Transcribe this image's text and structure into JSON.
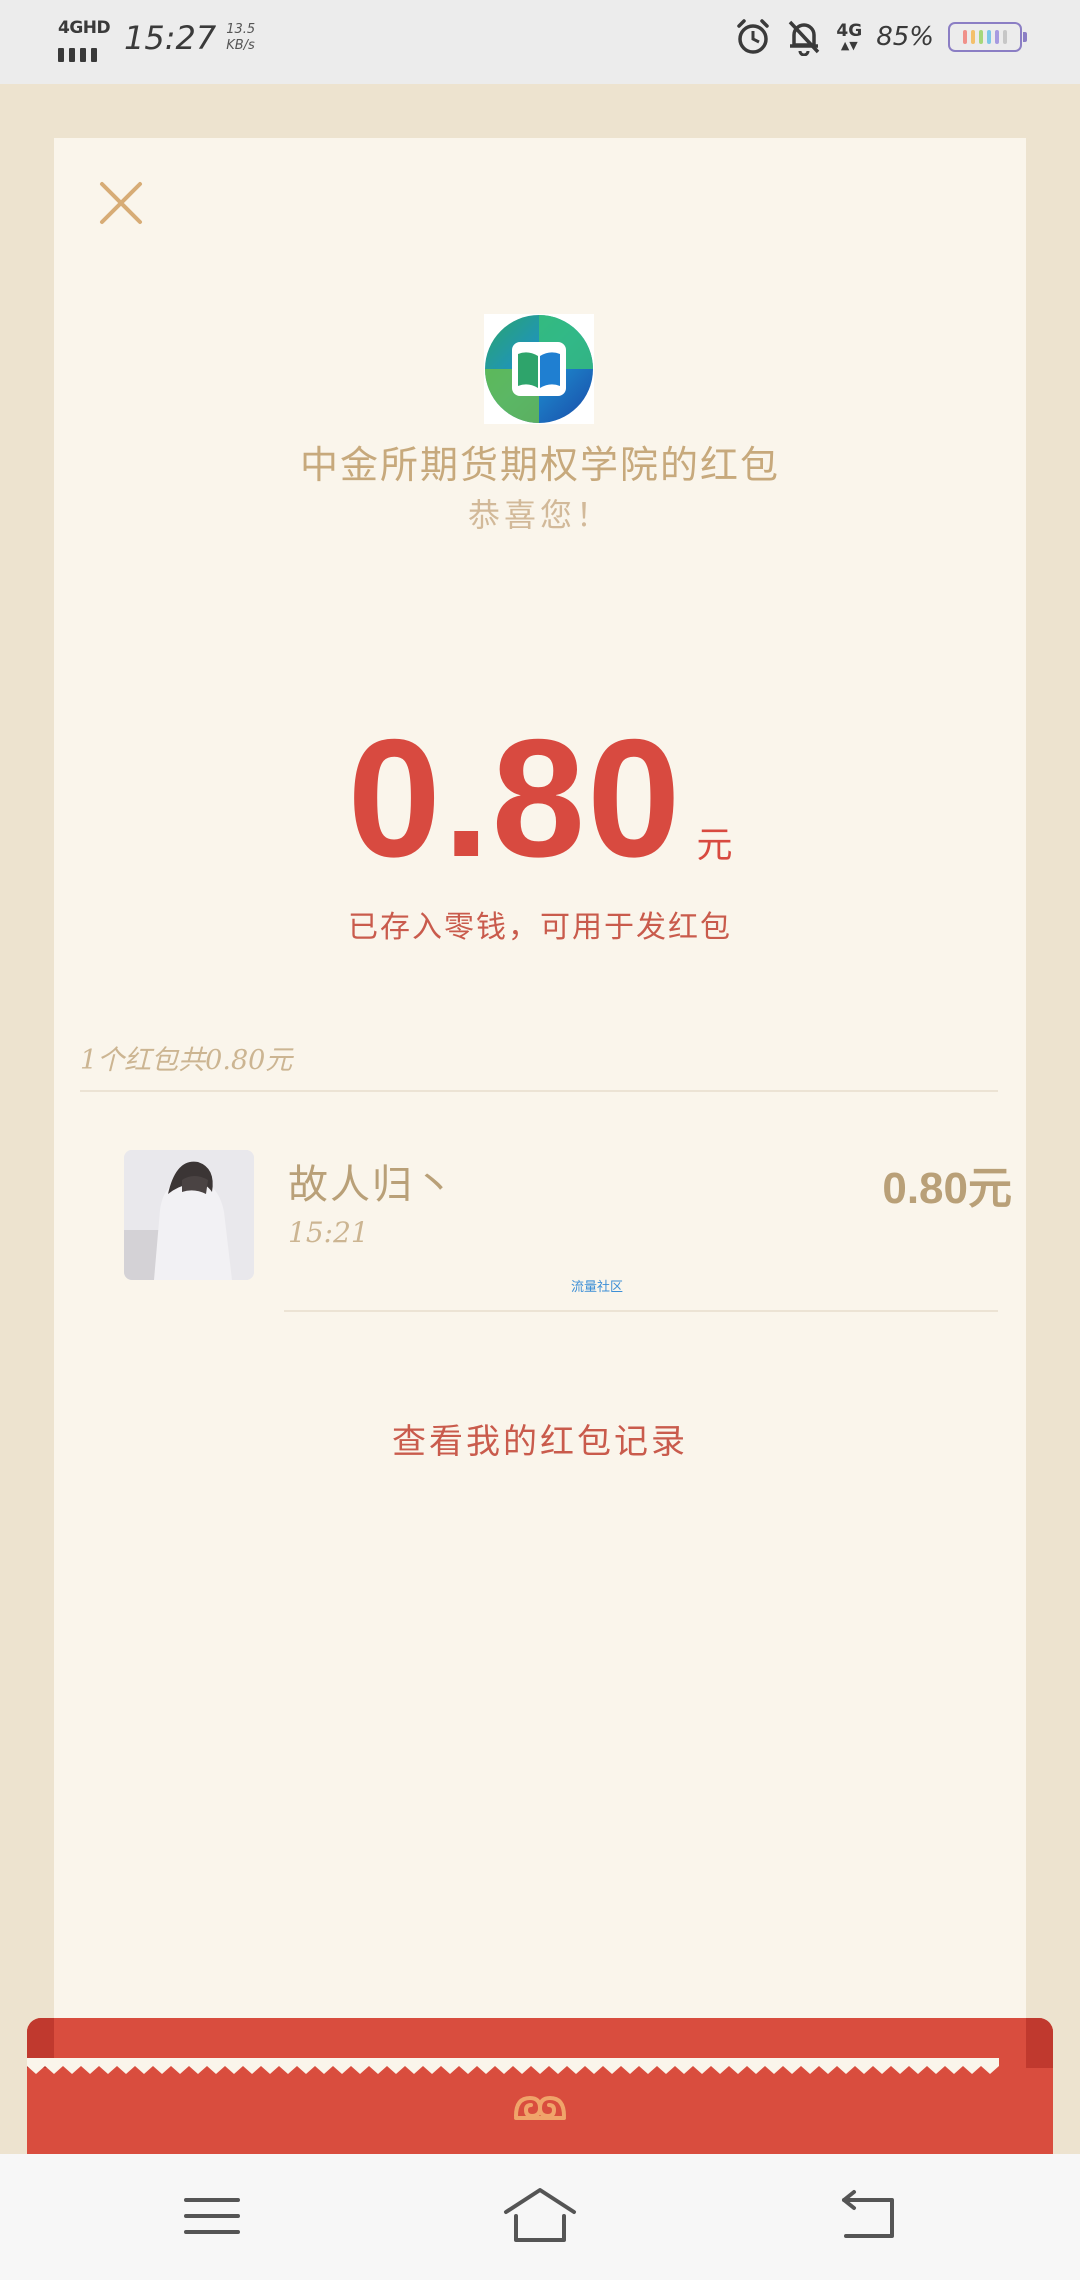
{
  "status_bar": {
    "network_type": "4GHD",
    "time": "15:27",
    "net_speed_value": "13.5",
    "net_speed_unit": "KB/s",
    "mobile_data": "4G",
    "battery_percent": "85%"
  },
  "envelope": {
    "sender_title": "中金所期货期权学院的红包",
    "congrats_text": "恭喜您！",
    "amount": "0.80",
    "amount_unit": "元",
    "amount_note": "已存入零钱，可用于发红包",
    "summary": "1个红包共0.80元"
  },
  "records": [
    {
      "name": "故人归丶",
      "time": "15:21",
      "amount": "0.80元"
    }
  ],
  "watermark": "流量社区",
  "history_link": "查看我的红包记录",
  "colors": {
    "amount_red": "#d84a40",
    "gold_text": "#c7a97c",
    "band_red": "#d94d3e",
    "card_bg": "#faf5eb",
    "page_bg": "#ede3cf"
  },
  "icons": {
    "close": "close-icon",
    "logo": "book-logo-icon",
    "nav_menu": "menu-icon",
    "nav_home": "home-icon",
    "nav_back": "back-icon"
  }
}
